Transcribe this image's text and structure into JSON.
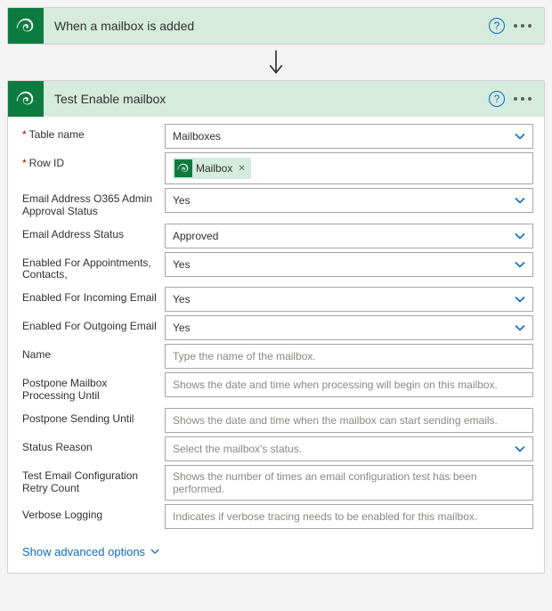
{
  "trigger": {
    "title": "When a mailbox is added"
  },
  "action": {
    "title": "Test Enable mailbox",
    "fields": {
      "table_name": {
        "label": "Table name",
        "value": "Mailboxes",
        "required": true,
        "dropdown": true
      },
      "row_id": {
        "label": "Row ID",
        "token": "Mailbox",
        "required": true,
        "dropdown": false
      },
      "email_o365_approval": {
        "label": "Email Address O365 Admin Approval Status",
        "value": "Yes",
        "dropdown": true
      },
      "email_status": {
        "label": "Email Address Status",
        "value": "Approved",
        "dropdown": true
      },
      "enabled_appt": {
        "label": "Enabled For Appointments, Contacts,",
        "value": "Yes",
        "dropdown": true
      },
      "enabled_in": {
        "label": "Enabled For Incoming Email",
        "value": "Yes",
        "dropdown": true
      },
      "enabled_out": {
        "label": "Enabled For Outgoing Email",
        "value": "Yes",
        "dropdown": true
      },
      "name": {
        "label": "Name",
        "placeholder": "Type the name of the mailbox."
      },
      "postpone_proc": {
        "label": "Postpone Mailbox Processing Until",
        "placeholder": "Shows the date and time when processing will begin on this mailbox."
      },
      "postpone_send": {
        "label": "Postpone Sending Until",
        "placeholder": "Shows the date and time when the mailbox can start sending emails."
      },
      "status_reason": {
        "label": "Status Reason",
        "placeholder": "Select the mailbox's status.",
        "dropdown": true
      },
      "retry_count": {
        "label": "Test Email Configuration Retry Count",
        "placeholder": "Shows the number of times an email configuration test has been performed."
      },
      "verbose": {
        "label": "Verbose Logging",
        "placeholder": "Indicates if verbose tracing needs to be enabled for this mailbox."
      }
    },
    "advanced": "Show advanced options"
  }
}
